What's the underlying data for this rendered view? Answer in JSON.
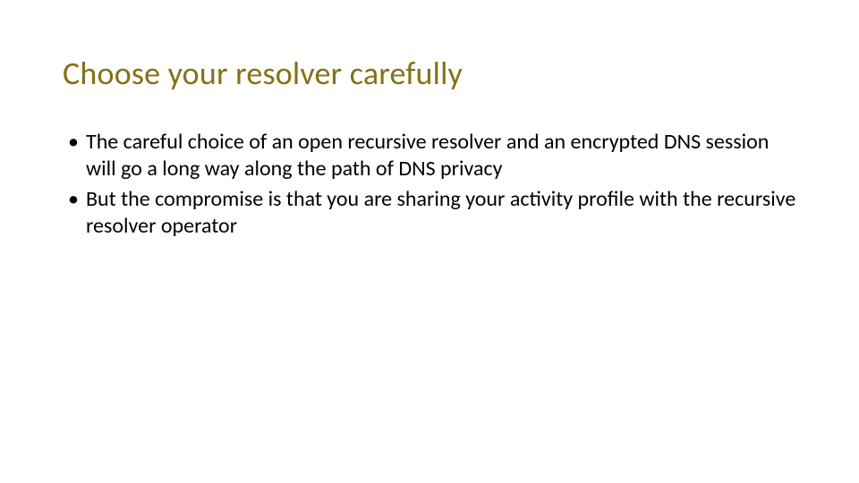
{
  "slide": {
    "title": "Choose your resolver carefully",
    "bullets": [
      "The careful choice of an open recursive resolver and an encrypted DNS session will go a long way along the path of DNS privacy",
      "But the compromise is that you are sharing your activity profile with the recursive resolver operator"
    ]
  }
}
